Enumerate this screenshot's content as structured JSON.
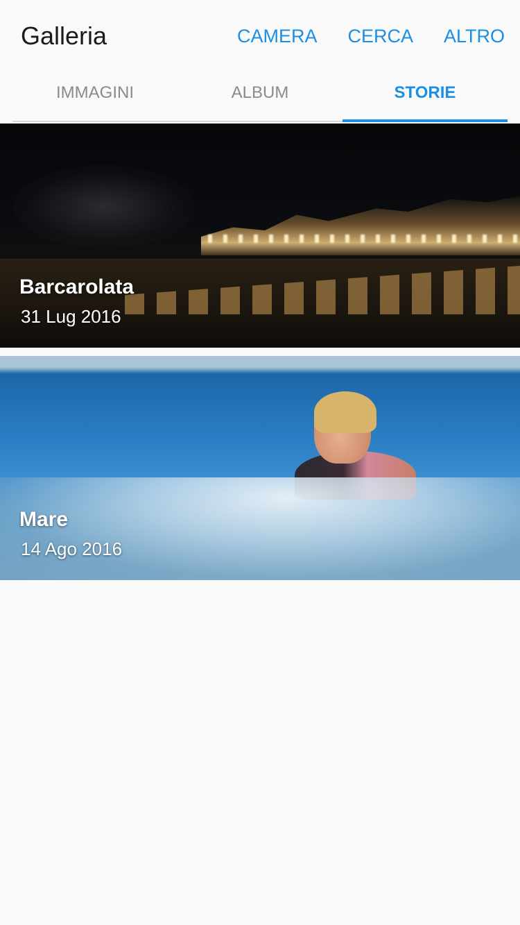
{
  "header": {
    "title": "Galleria",
    "actions": [
      "CAMERA",
      "CERCA",
      "ALTRO"
    ]
  },
  "tabs": [
    {
      "label": "IMMAGINI",
      "active": false
    },
    {
      "label": "ALBUM",
      "active": false
    },
    {
      "label": "STORIE",
      "active": true
    }
  ],
  "stories": [
    {
      "title": "Barcarolata",
      "date": "31 Lug 2016"
    },
    {
      "title": "Mare",
      "date": "14 Ago 2016"
    }
  ],
  "colors": {
    "accent": "#1a8fe3",
    "inactive_tab": "#8a8a8a",
    "background": "#f9f9f9"
  }
}
